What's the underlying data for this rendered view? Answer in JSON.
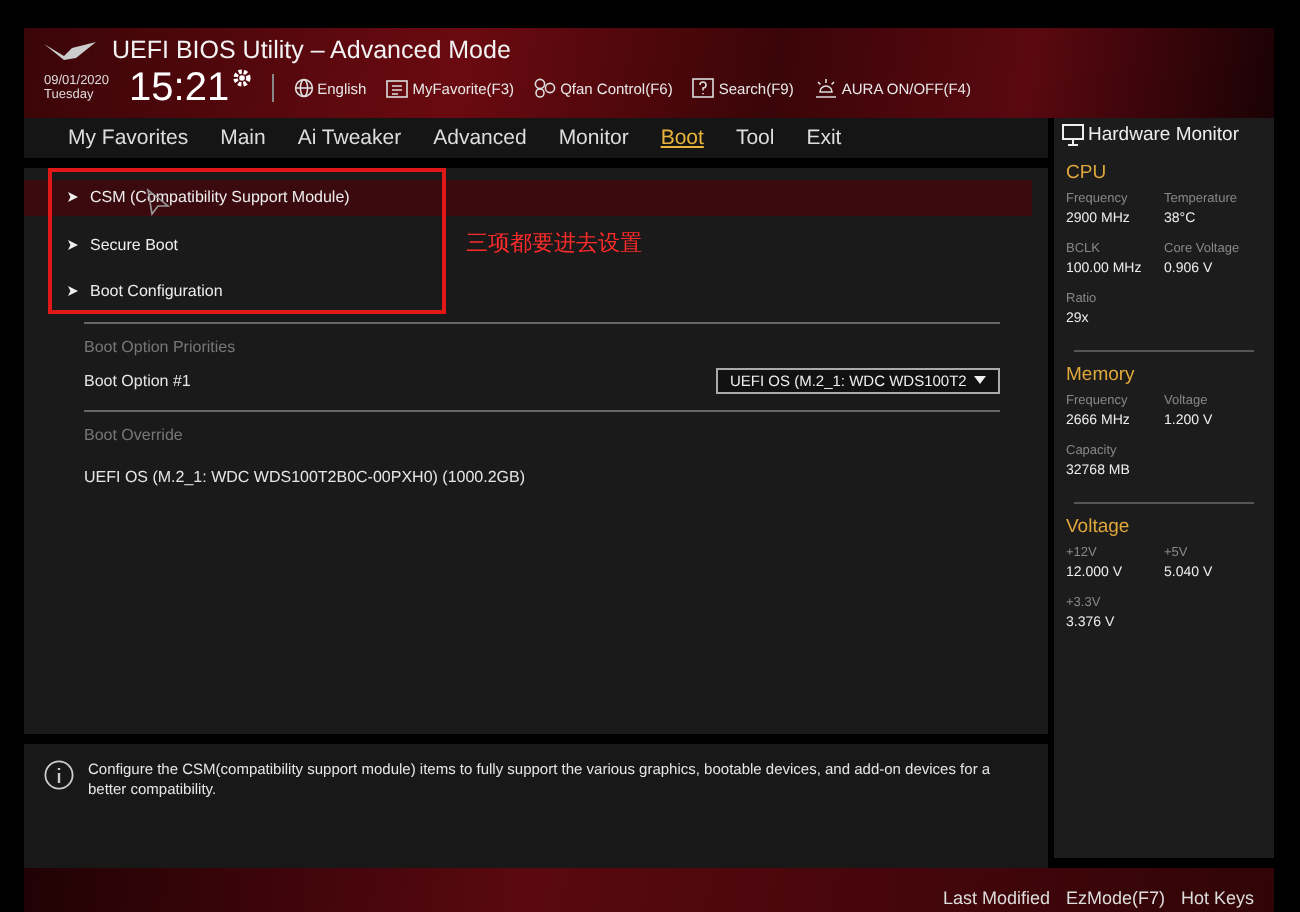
{
  "header": {
    "title": "UEFI BIOS Utility – Advanced Mode",
    "date": "09/01/2020",
    "day": "Tuesday",
    "time": "15:21",
    "tools": [
      {
        "kind": "globe",
        "label": "English"
      },
      {
        "kind": "favorite",
        "label": "MyFavorite(F3)"
      },
      {
        "kind": "fan",
        "label": "Qfan Control(F6)"
      },
      {
        "kind": "search",
        "label": "Search(F9)"
      },
      {
        "kind": "aura",
        "label": "AURA ON/OFF(F4)"
      }
    ]
  },
  "tabs": [
    {
      "label": "My Favorites",
      "selected": false
    },
    {
      "label": "Main",
      "selected": false
    },
    {
      "label": "Ai Tweaker",
      "selected": false
    },
    {
      "label": "Advanced",
      "selected": false
    },
    {
      "label": "Monitor",
      "selected": false
    },
    {
      "label": "Boot",
      "selected": true
    },
    {
      "label": "Tool",
      "selected": false
    },
    {
      "label": "Exit",
      "selected": false
    }
  ],
  "menu_items": [
    {
      "label": "CSM (Compatibility Support Module)",
      "selected": true
    },
    {
      "label": "Secure Boot",
      "selected": false
    },
    {
      "label": "Boot Configuration",
      "selected": false
    }
  ],
  "annotation": {
    "text": "三项都要进去设置"
  },
  "boot_option_priorities": {
    "heading": "Boot Option Priorities",
    "label": "Boot Option #1",
    "value": "UEFI OS (M.2_1: WDC WDS100T2"
  },
  "boot_override": {
    "heading": "Boot Override",
    "items": [
      "UEFI OS (M.2_1: WDC WDS100T2B0C-00PXH0) (1000.2GB)"
    ]
  },
  "info": "Configure the CSM(compatibility support module) items to fully support the various graphics, bootable devices, and add-on devices for a better compatibility.",
  "hardware_monitor": {
    "title": "Hardware Monitor",
    "groups": [
      {
        "title": "CPU",
        "fields": [
          {
            "label": "Frequency",
            "value": "2900 MHz"
          },
          {
            "label": "Temperature",
            "value": "38°C"
          },
          {
            "label": "BCLK",
            "value": "100.00 MHz"
          },
          {
            "label": "Core Voltage",
            "value": "0.906 V"
          },
          {
            "label": "Ratio",
            "value": "29x"
          }
        ]
      },
      {
        "title": "Memory",
        "fields": [
          {
            "label": "Frequency",
            "value": "2666 MHz"
          },
          {
            "label": "Voltage",
            "value": "1.200 V"
          },
          {
            "label": "Capacity",
            "value": "32768 MB"
          }
        ]
      },
      {
        "title": "Voltage",
        "fields": [
          {
            "label": "+12V",
            "value": "12.000 V"
          },
          {
            "label": "+5V",
            "value": "5.040 V"
          },
          {
            "label": "+3.3V",
            "value": "3.376 V"
          }
        ]
      }
    ]
  },
  "footer": {
    "items": [
      "Last Modified",
      "EzMode(F7)",
      "Hot Keys"
    ]
  }
}
